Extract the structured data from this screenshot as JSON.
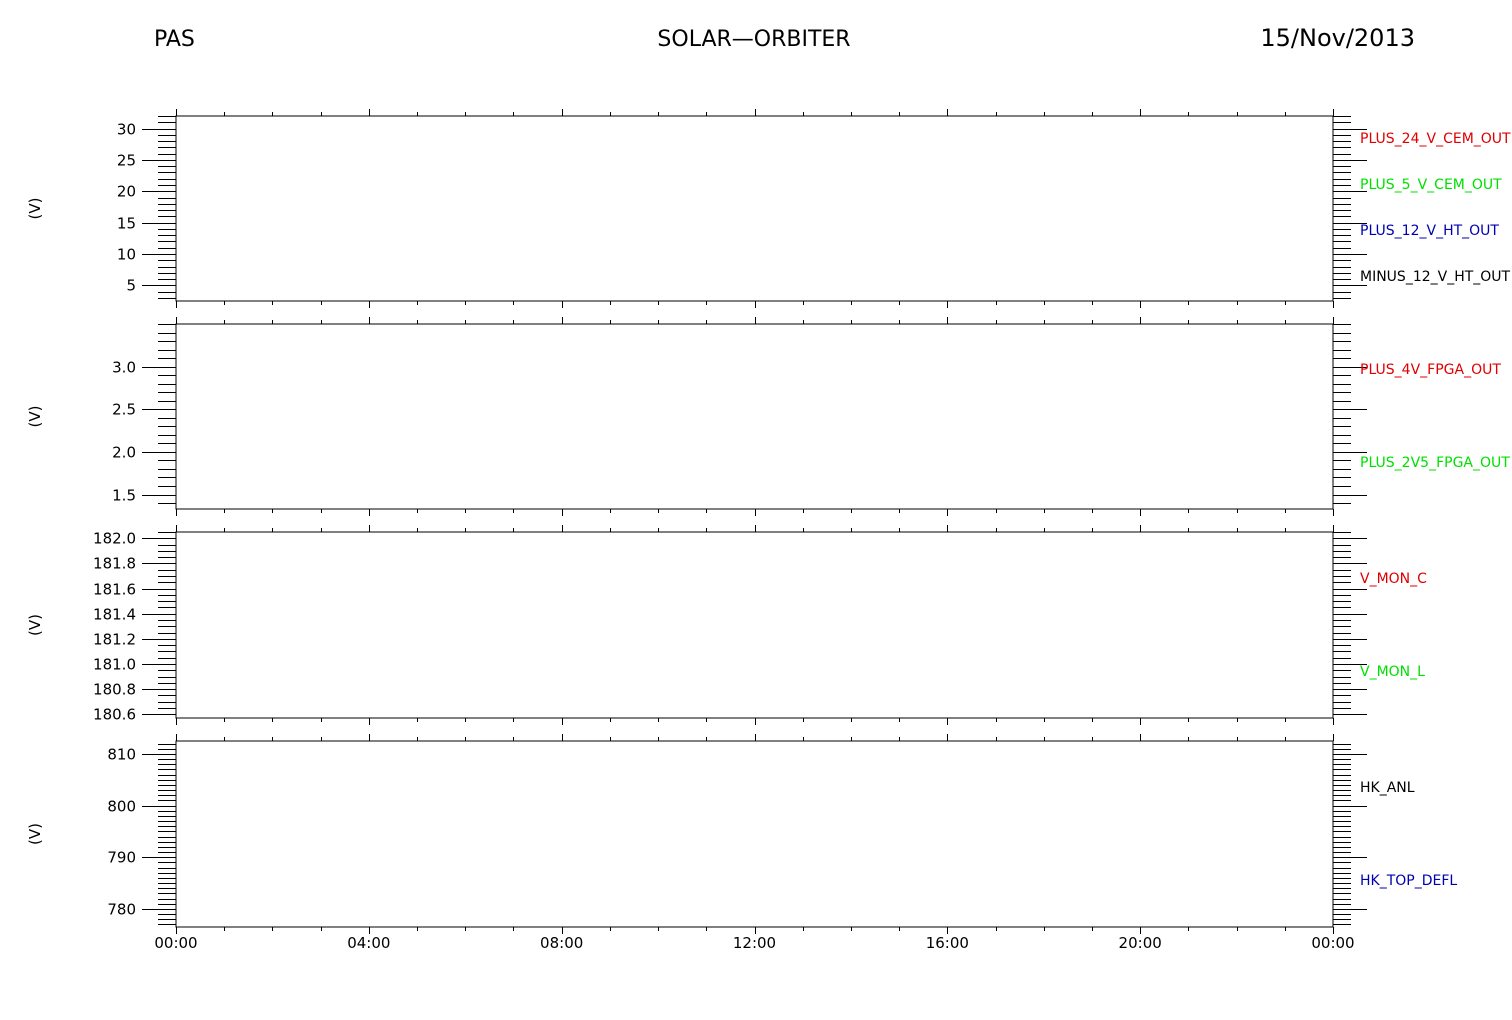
{
  "header": {
    "left": "PAS",
    "center": "SOLAR—ORBITER",
    "right": "15/Nov/2013"
  },
  "chart_data": [
    {
      "type": "line",
      "ylabel": "(V)",
      "ylim": [
        2.5,
        32.0
      ],
      "yticks": [
        5,
        10,
        15,
        20,
        25,
        30
      ],
      "ytick_labels": [
        "5",
        "10",
        "15",
        "20",
        "25",
        "30"
      ],
      "minor_step": 1,
      "series": [
        {
          "name": "PLUS_24_V_CEM_OUT",
          "color": "#e00000",
          "values": []
        },
        {
          "name": "PLUS_5_V_CEM_OUT",
          "color": "#00e000",
          "values": []
        },
        {
          "name": "PLUS_12_V_HT_OUT",
          "color": "#0000b0",
          "values": []
        },
        {
          "name": "MINUS_12_V_HT_OUT",
          "color": "#000000",
          "values": []
        }
      ]
    },
    {
      "type": "line",
      "ylabel": "(V)",
      "ylim": [
        1.33,
        3.5
      ],
      "yticks": [
        1.5,
        2.0,
        2.5,
        3.0
      ],
      "ytick_labels": [
        "1.5",
        "2.0",
        "2.5",
        "3.0"
      ],
      "minor_step": 0.1,
      "series": [
        {
          "name": "PLUS_4V_FPGA_OUT",
          "color": "#e00000",
          "values": []
        },
        {
          "name": "PLUS_2V5_FPGA_OUT",
          "color": "#00e000",
          "values": []
        }
      ]
    },
    {
      "type": "line",
      "ylabel": "(V)",
      "ylim": [
        180.57,
        182.05
      ],
      "yticks": [
        180.6,
        180.8,
        181.0,
        181.2,
        181.4,
        181.6,
        181.8,
        182.0
      ],
      "ytick_labels": [
        "180.6",
        "180.8",
        "181.0",
        "181.2",
        "181.4",
        "181.6",
        "181.8",
        "182.0"
      ],
      "minor_step": 0.05,
      "series": [
        {
          "name": "V_MON_C",
          "color": "#e00000",
          "values": []
        },
        {
          "name": "V_MON_L",
          "color": "#00e000",
          "values": []
        }
      ]
    },
    {
      "type": "line",
      "ylabel": "(V)",
      "ylim": [
        776.5,
        812.5
      ],
      "yticks": [
        780,
        790,
        800,
        810
      ],
      "ytick_labels": [
        "780",
        "790",
        "800",
        "810"
      ],
      "minor_step": 1,
      "series": [
        {
          "name": "HK_ANL",
          "color": "#000000",
          "values": []
        },
        {
          "name": "HK_TOP_DEFL",
          "color": "#0000b0",
          "values": []
        }
      ]
    }
  ],
  "xaxis": {
    "xlim": [
      0,
      24
    ],
    "xticks": [
      0,
      4,
      8,
      12,
      16,
      20,
      24
    ],
    "xtick_labels": [
      "00:00",
      "04:00",
      "08:00",
      "12:00",
      "16:00",
      "20:00",
      "00:00"
    ],
    "minor_step": 1
  }
}
